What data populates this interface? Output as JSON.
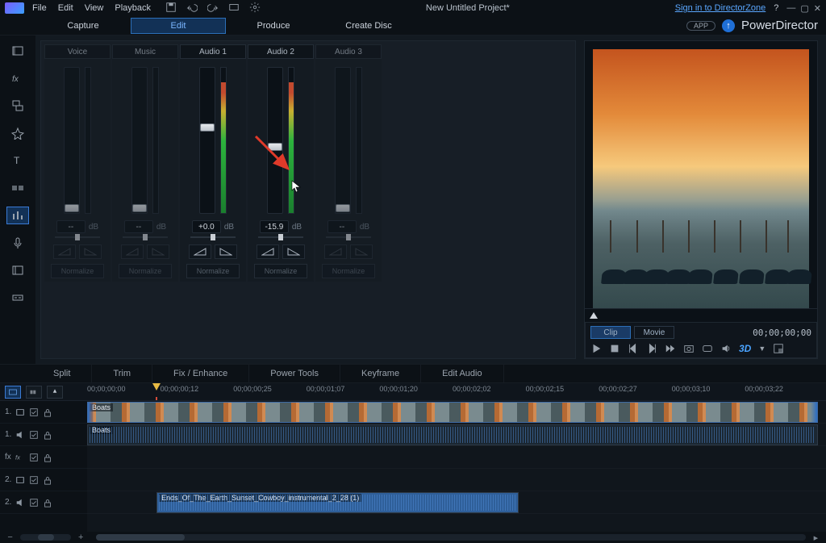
{
  "titlebar": {
    "menus": [
      "File",
      "Edit",
      "View",
      "Playback"
    ],
    "project": "New Untitled Project*",
    "signin": "Sign in to DirectorZone"
  },
  "tabs": {
    "items": [
      "Capture",
      "Edit",
      "Produce",
      "Create Disc"
    ],
    "active": 1,
    "brand_app": "APP",
    "brand_product": "PowerDirector"
  },
  "mixer": {
    "channels": [
      {
        "name": "Voice",
        "db": "--",
        "fader": 0.98,
        "meter": 0,
        "enabled": false
      },
      {
        "name": "Music",
        "db": "--",
        "fader": 0.98,
        "meter": 0,
        "enabled": false
      },
      {
        "name": "Audio 1",
        "db": "+0.0",
        "fader": 0.4,
        "meter": 0.9,
        "enabled": true
      },
      {
        "name": "Audio 2",
        "db": "-15.9",
        "fader": 0.54,
        "meter": 0.9,
        "enabled": true,
        "annot": true
      },
      {
        "name": "Audio 3",
        "db": "--",
        "fader": 0.98,
        "meter": 0,
        "enabled": false
      }
    ],
    "db_unit": "dB",
    "normalize": "Normalize"
  },
  "preview": {
    "tabs": [
      "Clip",
      "Movie"
    ],
    "active": 0,
    "timecode": "00;00;00;00",
    "three_d": "3D"
  },
  "toolstrip": {
    "items": [
      "Split",
      "Trim",
      "Fix / Enhance",
      "Power Tools",
      "Keyframe",
      "Edit Audio"
    ]
  },
  "timeline": {
    "ticks": [
      "00;00;00;00",
      "00;00;00;12",
      "00;00;00;25",
      "00;00;01;07",
      "00;00;01;20",
      "00;00;02;02",
      "00;00;02;15",
      "00;00;02;27",
      "00;00;03;10",
      "00;00;03;22"
    ],
    "playhead": 0.095,
    "rows": [
      {
        "label": "1.",
        "icons": [
          "film",
          "eye",
          "lock"
        ]
      },
      {
        "label": "1.",
        "icons": [
          "speaker",
          "eye",
          "lock"
        ]
      },
      {
        "label": "fx",
        "icons": [
          "fx",
          "eye",
          "lock"
        ]
      },
      {
        "label": "2.",
        "icons": [
          "film",
          "eye",
          "lock"
        ]
      },
      {
        "label": "2.",
        "icons": [
          "speaker",
          "eye",
          "lock"
        ]
      }
    ],
    "clips": {
      "video1": {
        "label": "Boats",
        "start": 0.0,
        "end": 1.0
      },
      "audio1": {
        "label": "Boats",
        "start": 0.0,
        "end": 1.0
      },
      "audio2": {
        "label": "Ends_Of_The_Earth_Sunset_Cowboy_instrumental_2_28 (1)",
        "start": 0.095,
        "end": 0.59
      }
    }
  }
}
